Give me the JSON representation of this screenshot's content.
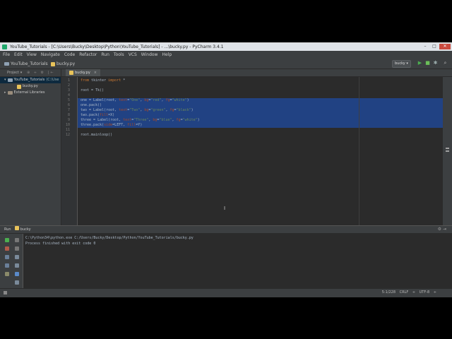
{
  "window": {
    "title": "YouTube_Tutorials - [C:\\Users\\Bucky\\Desktop\\Python\\YouTube_Tutorials] - ...\\bucky.py - PyCharm 3.4.1"
  },
  "menu": [
    "File",
    "Edit",
    "View",
    "Navigate",
    "Code",
    "Refactor",
    "Run",
    "Tools",
    "VCS",
    "Window",
    "Help"
  ],
  "breadcrumb": {
    "project": "YouTube_Tutorials",
    "file": "bucky.py"
  },
  "run_config": {
    "label": "bucky"
  },
  "project_panel": {
    "header": "Project",
    "items": [
      {
        "label": "YouTube_Tutorials",
        "suffix": "(C:\\Use"
      },
      {
        "label": "bucky.py"
      },
      {
        "label": "External Libraries"
      }
    ]
  },
  "editor": {
    "tab": "bucky.py",
    "line_numbers": [
      "1",
      "2",
      "3",
      "4",
      "5",
      "6",
      "7",
      "8",
      "9",
      "10",
      "11",
      "12"
    ],
    "lines": [
      "from tkinter import *",
      "",
      "root = Tk()",
      "",
      "one = Label(root, text=\"One\", bg=\"red\", fg=\"white\")",
      "one.pack()",
      "two = Label(root, text=\"Two\", bg=\"green\", fg=\"black\")",
      "two.pack(fill=X)",
      "three = Label(root, text=\"Three\", bg=\"blue\", fg=\"white\")",
      "three.pack(side=LEFT, fill=Y)",
      "",
      "root.mainloop()"
    ],
    "selected_lines": [
      5,
      10
    ]
  },
  "run_panel": {
    "title": "Run",
    "config": "bucky",
    "console": [
      "C:\\Python34\\python.exe C:/Users/Bucky/Desktop/Python/YouTube_Tutorials/bucky.py",
      "",
      "Process finished with exit code 0"
    ]
  },
  "status_bar": {
    "position": "5:1/228",
    "line_sep": "CRLF ÷",
    "encoding": "UTF-8 ÷"
  },
  "colors": {
    "selection": "#214283",
    "keyword": "#cc7832",
    "string": "#6a8759",
    "param": "#aa4926"
  }
}
